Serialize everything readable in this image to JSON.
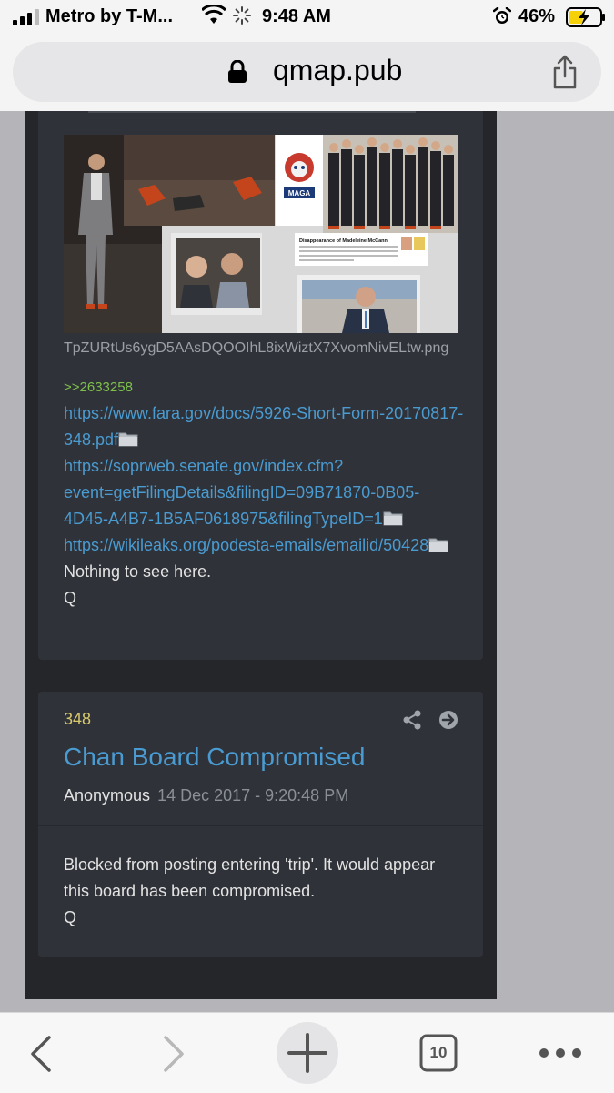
{
  "status_bar": {
    "carrier": "Metro by T-M...",
    "time": "9:48 AM",
    "battery_percent": "46%",
    "battery_level": 0.46
  },
  "url_bar": {
    "domain": "qmap.pub"
  },
  "post1": {
    "image_filename": "TpZURtUs6ygD5AAsDQOOIhL8ixWiztX7XvomNivELtw.png",
    "collage_captions": {
      "logo_text": "MAGA",
      "article_title": "Disappearance of Madeleine McCann"
    },
    "reply_ref": ">>2633258",
    "links": [
      "https://www.fara.gov/docs/5926-Short-Form-20170817-348.pdf",
      "https://soprweb.senate.gov/index.cfm?event=getFilingDetails&filingID=09B71870-0B05-4D45-A4B7-1B5AF0618975&filingTypeID=1",
      "https://wikileaks.org/podesta-emails/emailid/50428"
    ],
    "text_line": "Nothing to see here.",
    "signature": "Q"
  },
  "post2": {
    "number": "348",
    "title": "Chan Board Compromised",
    "author": "Anonymous",
    "date": "14 Dec 2017 - 9:20:48 PM",
    "body": "Blocked from posting entering 'trip'. It would appear this board has been compromised.",
    "signature": "Q"
  },
  "toolbar": {
    "tab_count": "10"
  },
  "colors": {
    "link": "#4a9bd1",
    "reply_ref": "#7ec04b",
    "post_number": "#d6c86c",
    "card_bg": "#2f3238",
    "column_bg": "#242629"
  },
  "icons": [
    "signal-icon",
    "wifi-icon",
    "loading-spinner-icon",
    "alarm-icon",
    "battery-charging-icon",
    "lock-icon",
    "share-icon",
    "folder-icon",
    "arrow-right-icon",
    "back-icon",
    "forward-icon",
    "plus-icon",
    "tabs-icon",
    "more-icon"
  ]
}
